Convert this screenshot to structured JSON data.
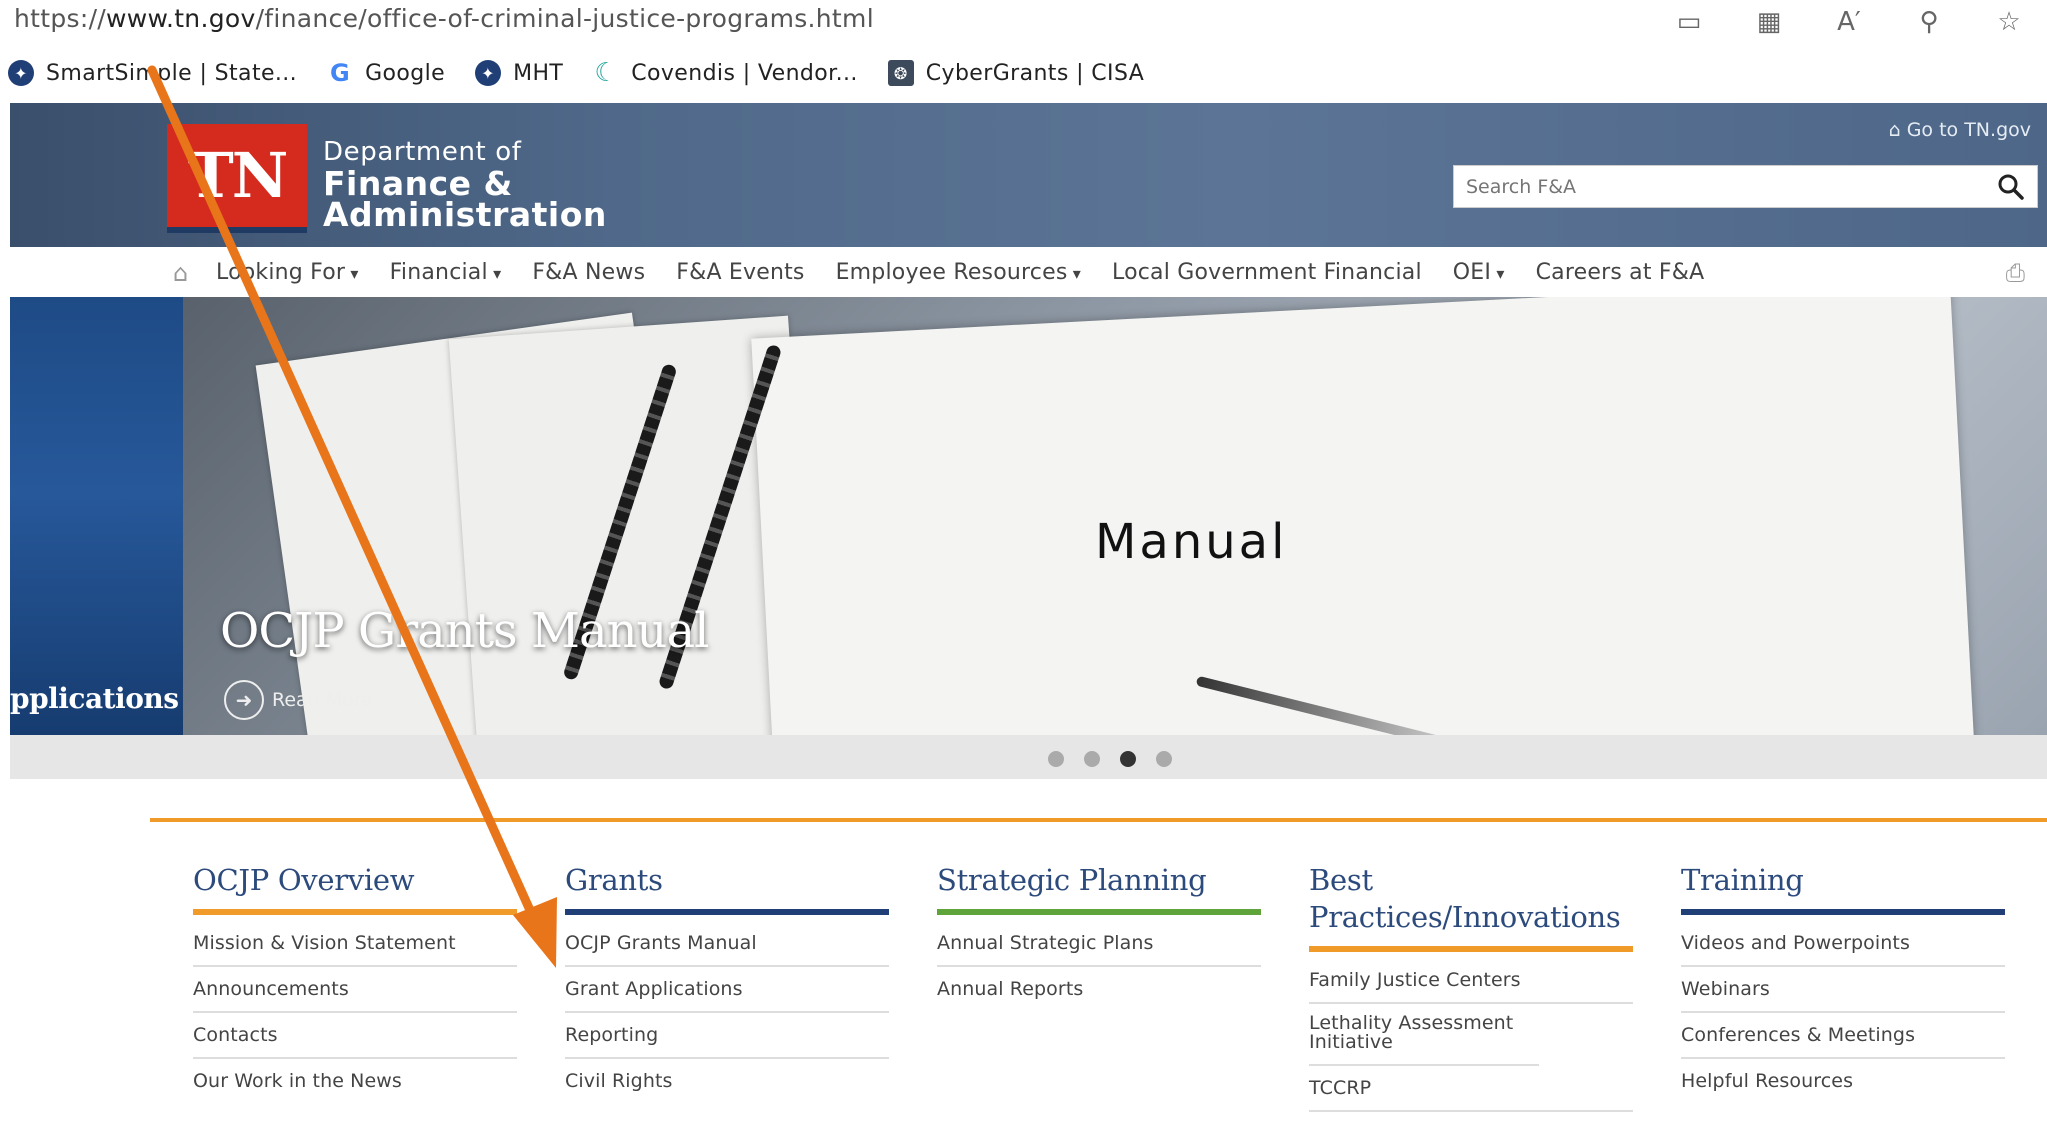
{
  "browser": {
    "url_prefix": "https://",
    "url_host": "www.tn.gov",
    "url_path": "/finance/office-of-criminal-justice-programs.html",
    "bookmarks": [
      {
        "label": "SmartSimple | State...",
        "icon": "tn-seal-icon"
      },
      {
        "label": "Google",
        "icon": "google-g-icon"
      },
      {
        "label": "MHT",
        "icon": "tn-seal-icon"
      },
      {
        "label": "Covendis | Vendor...",
        "icon": "covendis-icon"
      },
      {
        "label": "CyberGrants | CISA",
        "icon": "cisa-seal-icon"
      }
    ]
  },
  "header": {
    "logo_text": "TN",
    "dept_line1": "Department of",
    "dept_line2": "Finance &",
    "dept_line3": "Administration",
    "goto_label": "Go to TN.gov",
    "search_placeholder": "Search F&A"
  },
  "nav": {
    "items": [
      {
        "label": "Looking For",
        "dropdown": true
      },
      {
        "label": "Financial",
        "dropdown": true
      },
      {
        "label": "F&A News",
        "dropdown": false
      },
      {
        "label": "F&A Events",
        "dropdown": false
      },
      {
        "label": "Employee Resources",
        "dropdown": true
      },
      {
        "label": "Local Government Financial",
        "dropdown": false
      },
      {
        "label": "OEI",
        "dropdown": true
      },
      {
        "label": "Careers at F&A",
        "dropdown": false
      }
    ]
  },
  "hero": {
    "left_slide_text": "pplications",
    "title": "OCJP Grants Manual",
    "read_more": "Read More",
    "image_word": "Manual",
    "slides": 4,
    "active_slide": 3
  },
  "columns": [
    {
      "title": "OCJP Overview",
      "rule_color": "#f09a2a",
      "links": [
        "Mission & Vision Statement",
        "Announcements",
        "Contacts",
        "Our Work in the News"
      ]
    },
    {
      "title": "Grants",
      "rule_color": "#1f3f76",
      "links": [
        "OCJP Grants Manual",
        "Grant Applications",
        "Reporting",
        "Civil Rights"
      ]
    },
    {
      "title": "Strategic Planning",
      "rule_color": "#5fa33b",
      "links": [
        "Annual Strategic Plans",
        "Annual Reports"
      ]
    },
    {
      "title": "Best Practices/Innovations",
      "rule_color": "#f09a2a",
      "links": [
        "Family Justice Centers",
        "Lethality Assessment Initiative",
        "TCCRP"
      ]
    },
    {
      "title": "Training",
      "rule_color": "#1f3f76",
      "links": [
        "Videos and Powerpoints",
        "Webinars",
        "Conferences & Meetings",
        "Helpful Resources"
      ]
    }
  ],
  "annotation": {
    "arrow_color": "#e8751a"
  }
}
